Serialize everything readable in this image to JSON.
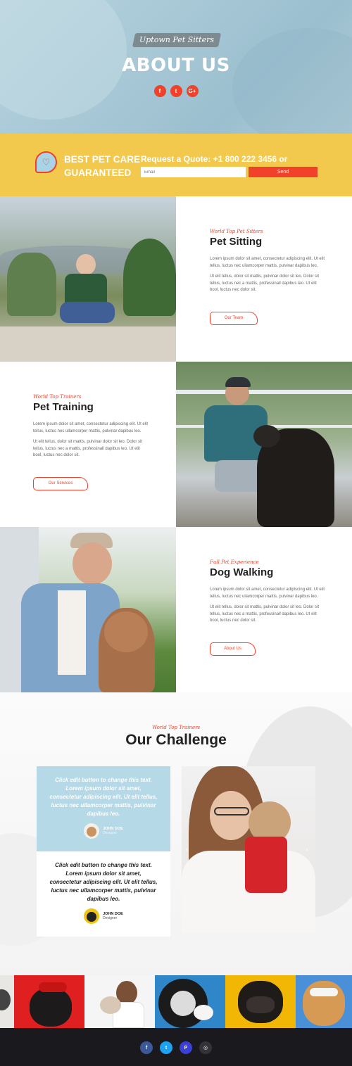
{
  "hero": {
    "tagline": "Uptown Pet Sitters",
    "title": "ABOUT US",
    "social": [
      {
        "icon": "facebook-icon",
        "glyph": "f"
      },
      {
        "icon": "twitter-icon",
        "glyph": "t"
      },
      {
        "icon": "google-plus-icon",
        "glyph": "G+"
      }
    ]
  },
  "band": {
    "title_line1": "BEST PET CARE",
    "title_line2": "GUARANTEED",
    "quote": "Request a Quote: +1 800 222 3456 or",
    "email_placeholder": "Email",
    "send_label": "Send"
  },
  "sections": [
    {
      "kicker": "World Top Pet Sitters",
      "heading": "Pet Sitting",
      "para1": "Lorem ipsum dolor sit amet, consectetur adipiscing elit. Ut elit tellus, luctus nec ullamcorper mattis, pulvinar dapibus leo.",
      "para2": "Ut elit tellus, dolor sit mattis, pulvinar dolor sit leo. Dolor sit tellus, luctus nec a mattis, professinall dapibus leo. Ut elit bool, luctus nec dolor sit.",
      "button": "Our Team"
    },
    {
      "kicker": "World Top Trainers",
      "heading": "Pet Training",
      "para1": "Lorem ipsum dolor sit amet, consectetur adipiscing elit. Ut elit tellus, luctus nec ullamcorper mattis, pulvinar dapibus leo.",
      "para2": "Ut elit tellus, dolor sit mattis, pulvinar dolor sit leo. Dolor sit tellus, luctus nec a mattis, professinall dapibus leo. Ut elit bool, luctus nec dolor sit.",
      "button": "Our Services"
    },
    {
      "kicker": "Full Pet Experience",
      "heading": "Dog Walking",
      "para1": "Lorem ipsum dolor sit amet, consectetur adipiscing elit. Ut elit tellus, luctus nec ullamcorper mattis, pulvinar dapibus leo.",
      "para2": "Ut elit tellus, dolor sit mattis, pulvinar dolor sit leo. Dolor sit tellus, luctus nec a mattis, professinall dapibus leo. Ut elit bool, luctus nec dolor sit.",
      "button": "About Us"
    }
  ],
  "challenge": {
    "kicker": "World Top Trainers",
    "title": "Our Challenge",
    "testimonials": [
      {
        "text": "Click edit button to change this text. Lorem ipsum dolor sit amet, consectetur adipiscing elit. Ut elit tellus, luctus nec ullamcorper mattis, pulvinar dapibus leo.",
        "name": "JOHN DOE",
        "role": "Designer"
      },
      {
        "text": "Click edit button to change this text. Lorem ipsum dolor sit amet, consectetur adipiscing elit. Ut elit tellus, luctus nec ullamcorper mattis, pulvinar dapibus leo.",
        "name": "JOHN DOE",
        "role": "Designer"
      }
    ],
    "prev_glyph": "‹",
    "next_glyph": "›"
  },
  "footer": {
    "social": [
      {
        "icon": "facebook-icon",
        "glyph": "f",
        "color": "#3b5998"
      },
      {
        "icon": "twitter-icon",
        "glyph": "t",
        "color": "#1da1f2"
      },
      {
        "icon": "pinterest-icon",
        "glyph": "P",
        "color": "#3a3fd6"
      },
      {
        "icon": "instagram-icon",
        "glyph": "◎",
        "color": "#333338"
      }
    ]
  },
  "colors": {
    "accent": "#f0412b",
    "band": "#f2c94c",
    "hero": "#a8c8d6",
    "card_blue": "#b6d9e8",
    "footer": "#1a1a1e"
  }
}
